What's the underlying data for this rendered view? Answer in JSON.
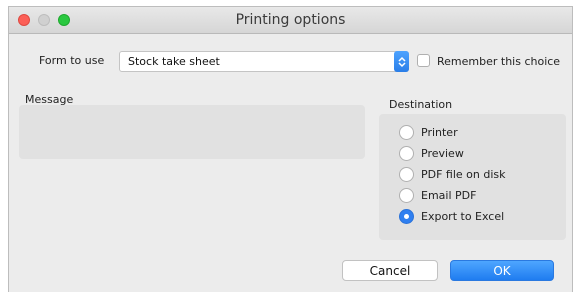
{
  "window": {
    "title": "Printing options"
  },
  "form": {
    "label": "Form to use",
    "selected": "Stock take sheet",
    "remember_label": "Remember this choice"
  },
  "message": {
    "label": "Message"
  },
  "destination": {
    "label": "Destination",
    "options": [
      "Printer",
      "Preview",
      "PDF file on disk",
      "Email PDF",
      "Export to Excel"
    ],
    "selected": "Export to Excel"
  },
  "buttons": {
    "cancel": "Cancel",
    "ok": "OK"
  },
  "colors": {
    "accent": "#2f7ff0",
    "close": "#fc5f57",
    "maximize": "#2ac840"
  }
}
